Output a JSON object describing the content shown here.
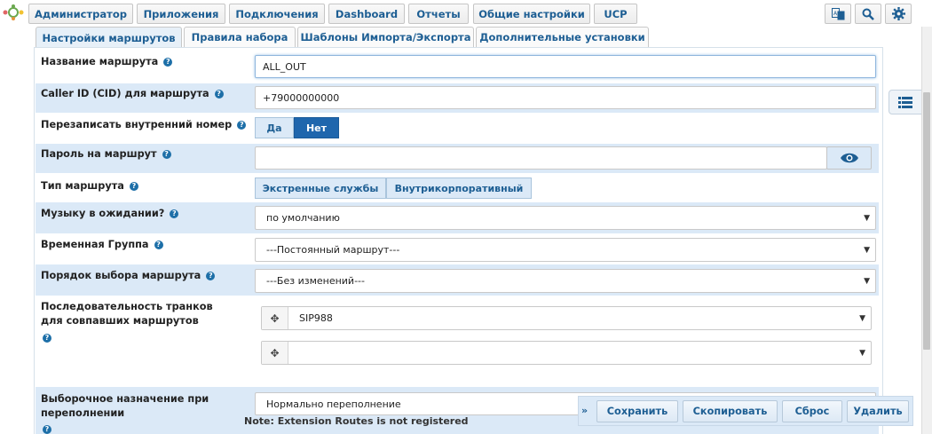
{
  "topnav": {
    "items": [
      "Администратор",
      "Приложения",
      "Подключения",
      "Dashboard",
      "Отчеты",
      "Общие настройки",
      "UCP"
    ],
    "icons": [
      "translate-icon",
      "search-icon",
      "gear-icon"
    ]
  },
  "tabs": [
    "Настройки маршрутов",
    "Правила набора",
    "Шаблоны Импорта/Экспорта",
    "Дополнительные установки"
  ],
  "form": {
    "route_name": {
      "label": "Название маршрута",
      "value": "ALL_OUT"
    },
    "caller_id": {
      "label": "Caller ID (CID) для маршрута",
      "value": "+79000000000"
    },
    "overwrite_ext": {
      "label": "Перезаписать внутренний номер",
      "options": [
        "Да",
        "Нет"
      ],
      "selected": "Нет"
    },
    "route_password": {
      "label": "Пароль на маршрут",
      "value": ""
    },
    "route_type": {
      "label": "Тип маршрута",
      "options": [
        "Экстренные службы",
        "Внутрикорпоративный"
      ]
    },
    "music_on_hold": {
      "label": "Музыку в ожидании?",
      "value": "по умолчанию"
    },
    "time_group": {
      "label": "Временная Группа",
      "value": "---Постоянный маршрут---"
    },
    "route_position": {
      "label": "Порядок выбора маршрута",
      "value": "---Без изменений---"
    },
    "trunk_sequence": {
      "label": "Последовательность транков для совпавших маршрутов",
      "trunks": [
        "SIP988",
        ""
      ]
    },
    "overflow_dest": {
      "label": "Выборочное назначение при переполнении",
      "value": "Нормально переполнение"
    }
  },
  "note": "Note: Extension Routes is not registered",
  "actions": [
    "Сохранить",
    "Скопировать",
    "Сброс",
    "Удалить"
  ],
  "colors": {
    "accent": "#1d5e93",
    "active_segment": "#1f66ad",
    "row_shade": "#dbe9f7"
  }
}
